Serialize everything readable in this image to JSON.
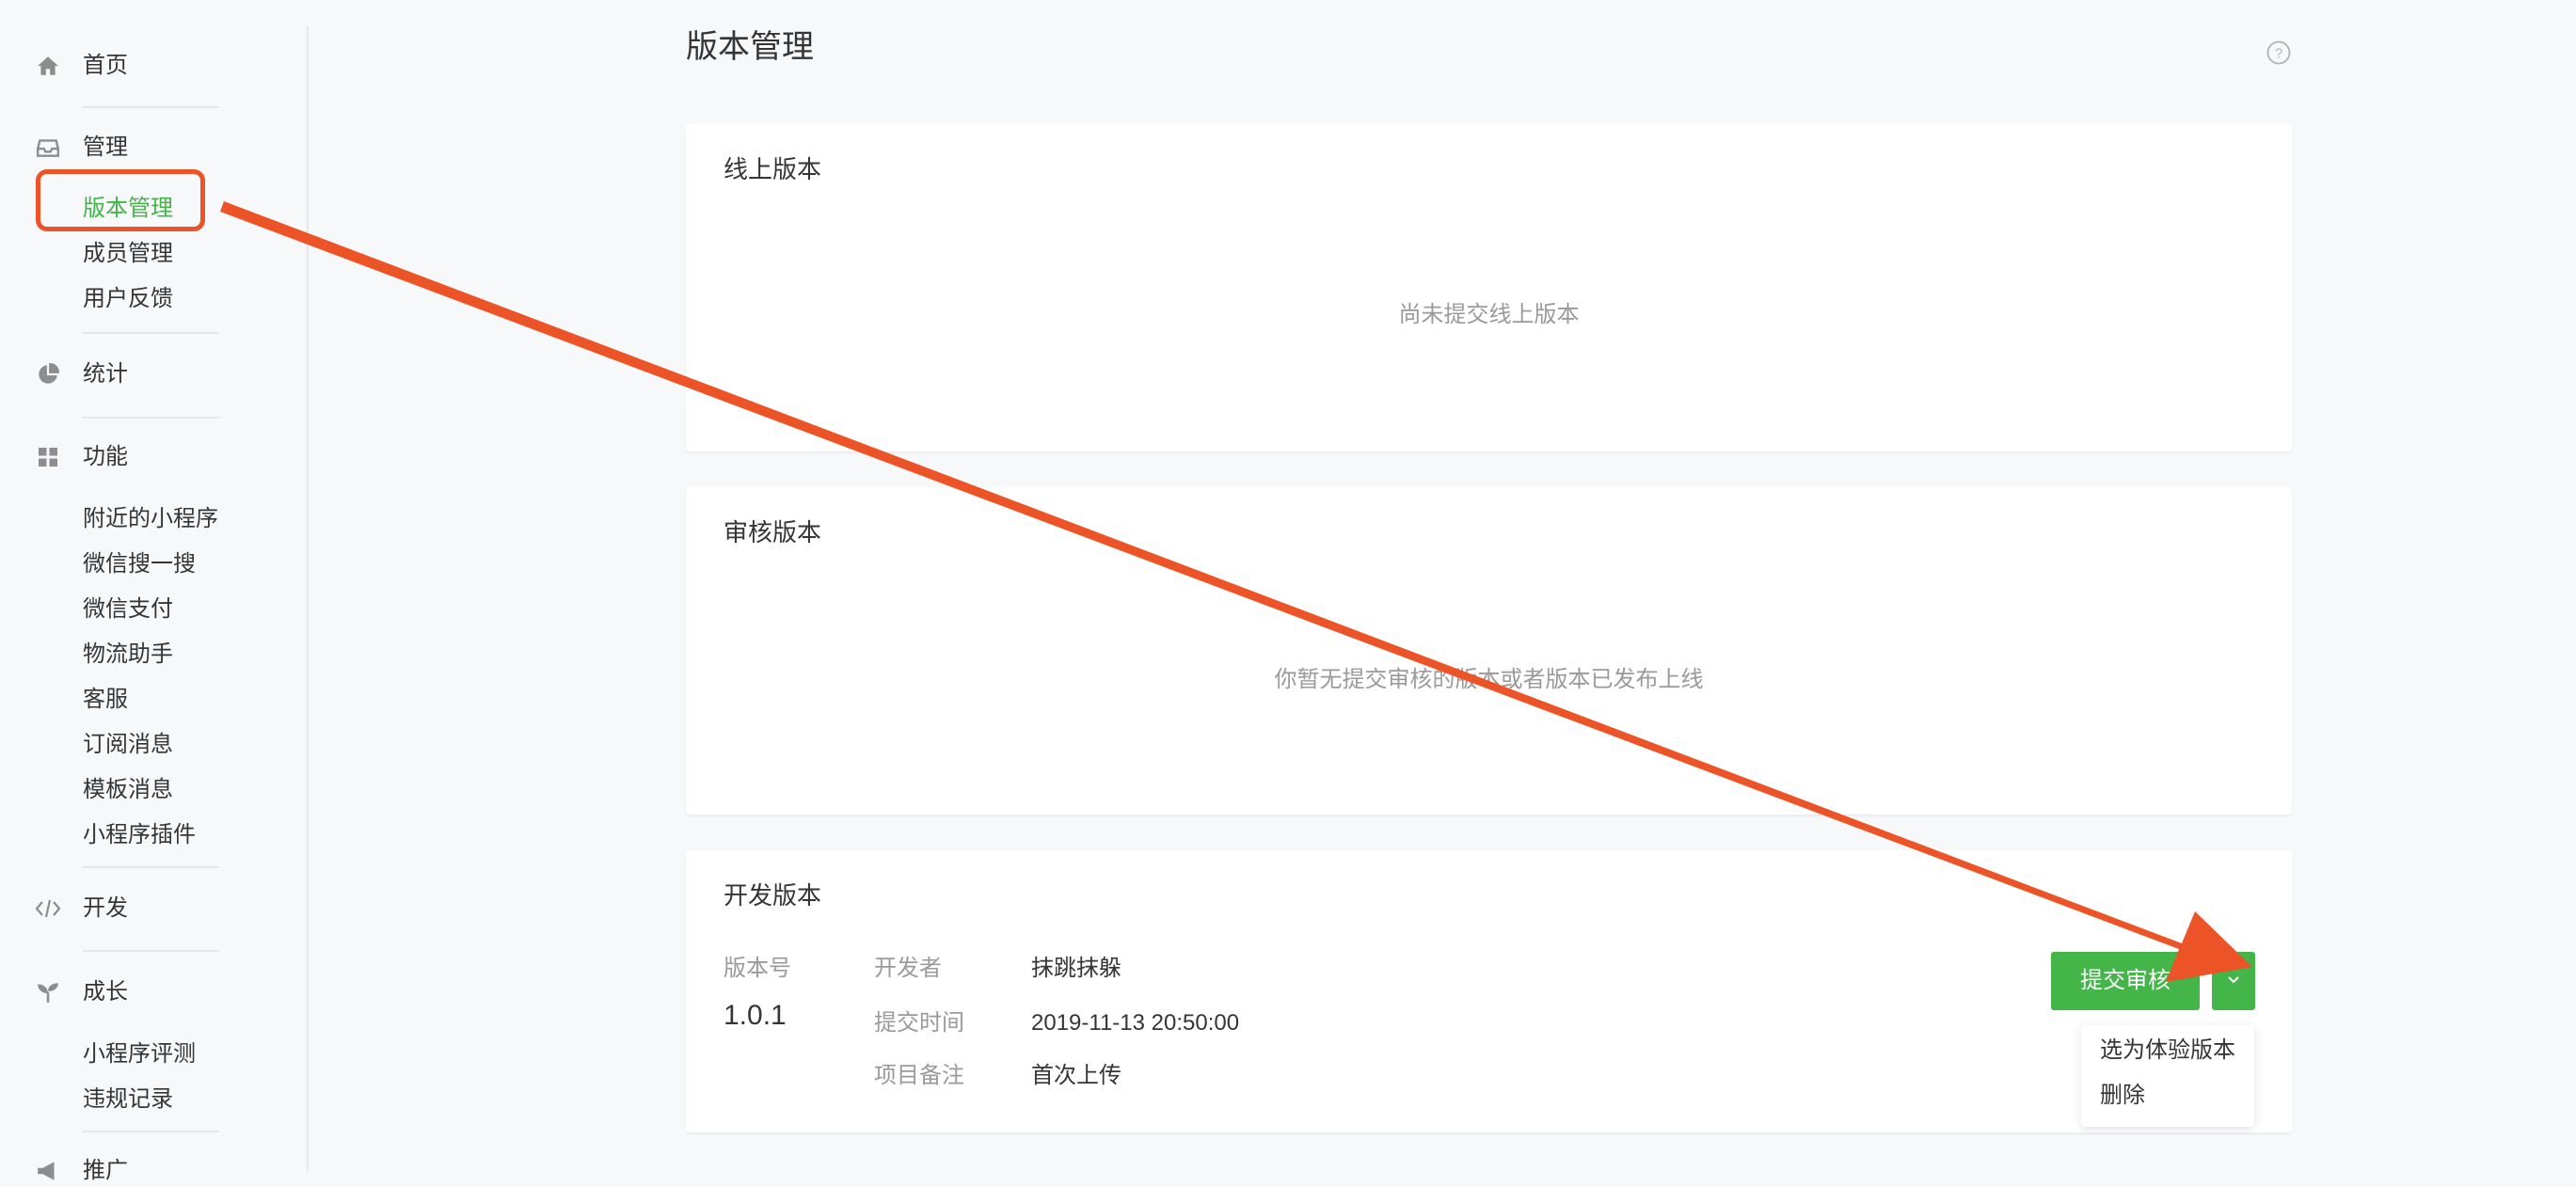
{
  "sidebar": {
    "home": "首页",
    "manage": {
      "label": "管理",
      "items": [
        "版本管理",
        "成员管理",
        "用户反馈"
      ]
    },
    "stats": "统计",
    "features": {
      "label": "功能",
      "items": [
        "附近的小程序",
        "微信搜一搜",
        "微信支付",
        "物流助手",
        "客服",
        "订阅消息",
        "模板消息",
        "小程序插件"
      ]
    },
    "develop": "开发",
    "growth": {
      "label": "成长",
      "items": [
        "小程序评测",
        "违规记录"
      ]
    },
    "promote": "推广"
  },
  "page": {
    "title": "版本管理"
  },
  "online": {
    "title": "线上版本",
    "empty": "尚未提交线上版本"
  },
  "review": {
    "title": "审核版本",
    "empty": "你暂无提交审核的版本或者版本已发布上线"
  },
  "dev": {
    "title": "开发版本",
    "version_label": "版本号",
    "version": "1.0.1",
    "developer_label": "开发者",
    "developer": "抹跳抹躲",
    "time_label": "提交时间",
    "time": "2019-11-13 20:50:00",
    "note_label": "项目备注",
    "note": "首次上传",
    "submit_button": "提交审核"
  },
  "dropdown": {
    "items": [
      "选为体验版本",
      "删除"
    ]
  },
  "colors": {
    "accent": "#44b549",
    "annotation": "#ec5327"
  },
  "icons": [
    "home-icon",
    "inbox-icon",
    "pie-chart-icon",
    "grid-icon",
    "code-icon",
    "sprout-icon",
    "megaphone-icon",
    "help-icon",
    "chevron-down-icon"
  ]
}
